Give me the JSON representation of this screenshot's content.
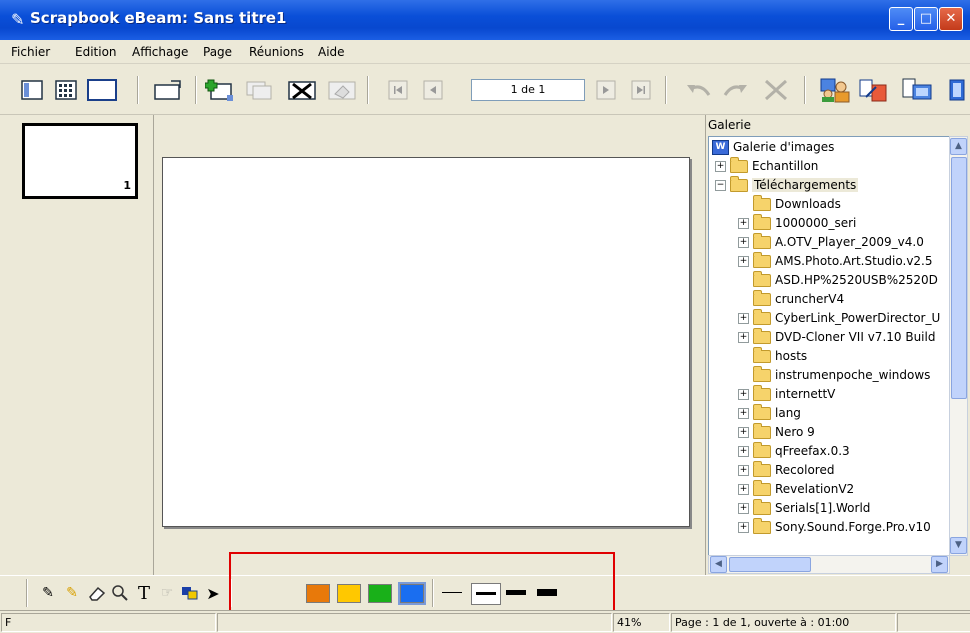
{
  "window": {
    "title": "Scrapbook eBeam: Sans titre1",
    "buttons": [
      "minimize-icon",
      "maximize-icon",
      "close-icon"
    ]
  },
  "menu": {
    "items": [
      "Fichier",
      "Edition",
      "Affichage",
      "Page",
      "Réunions",
      "Aide"
    ]
  },
  "toolbar": {
    "page_indicator": "1 de 1"
  },
  "thumbnails": {
    "items": [
      {
        "number": "1"
      }
    ]
  },
  "gallery": {
    "header": "Galerie",
    "root": "Galerie d'images",
    "items": [
      {
        "label": "Echantillon",
        "expander": "+"
      },
      {
        "label": "Téléchargements",
        "expander": "−"
      },
      {
        "label": "Downloads",
        "expander": ""
      },
      {
        "label": "1000000_seri",
        "expander": "+"
      },
      {
        "label": "A.OTV_Player_2009_v4.0",
        "expander": "+"
      },
      {
        "label": "AMS.Photo.Art.Studio.v2.5",
        "expander": "+"
      },
      {
        "label": "ASD.HP%2520USB%2520D",
        "expander": ""
      },
      {
        "label": "cruncherV4",
        "expander": ""
      },
      {
        "label": "CyberLink_PowerDirector_U",
        "expander": "+"
      },
      {
        "label": "DVD-Cloner VII v7.10 Build",
        "expander": "+"
      },
      {
        "label": "hosts",
        "expander": ""
      },
      {
        "label": "instrumenpoche_windows",
        "expander": ""
      },
      {
        "label": "internettV",
        "expander": "+"
      },
      {
        "label": "lang",
        "expander": "+"
      },
      {
        "label": "Nero 9",
        "expander": "+"
      },
      {
        "label": "qFreefax.0.3",
        "expander": "+"
      },
      {
        "label": "Recolored",
        "expander": "+"
      },
      {
        "label": "RevelationV2",
        "expander": "+"
      },
      {
        "label": "Serials[1].World",
        "expander": "+"
      },
      {
        "label": "Sony.Sound.Forge.Pro.v10",
        "expander": "+"
      }
    ]
  },
  "drawing_tools": {
    "colors": [
      "#e8790a",
      "#ffc800",
      "#19b019",
      "#1a6ef0"
    ],
    "line_widths": [
      1,
      3,
      5,
      7
    ]
  },
  "status": {
    "left": "F",
    "zoom": "41%",
    "page_info": "Page : 1 de 1, ouverte à : 01:00"
  }
}
